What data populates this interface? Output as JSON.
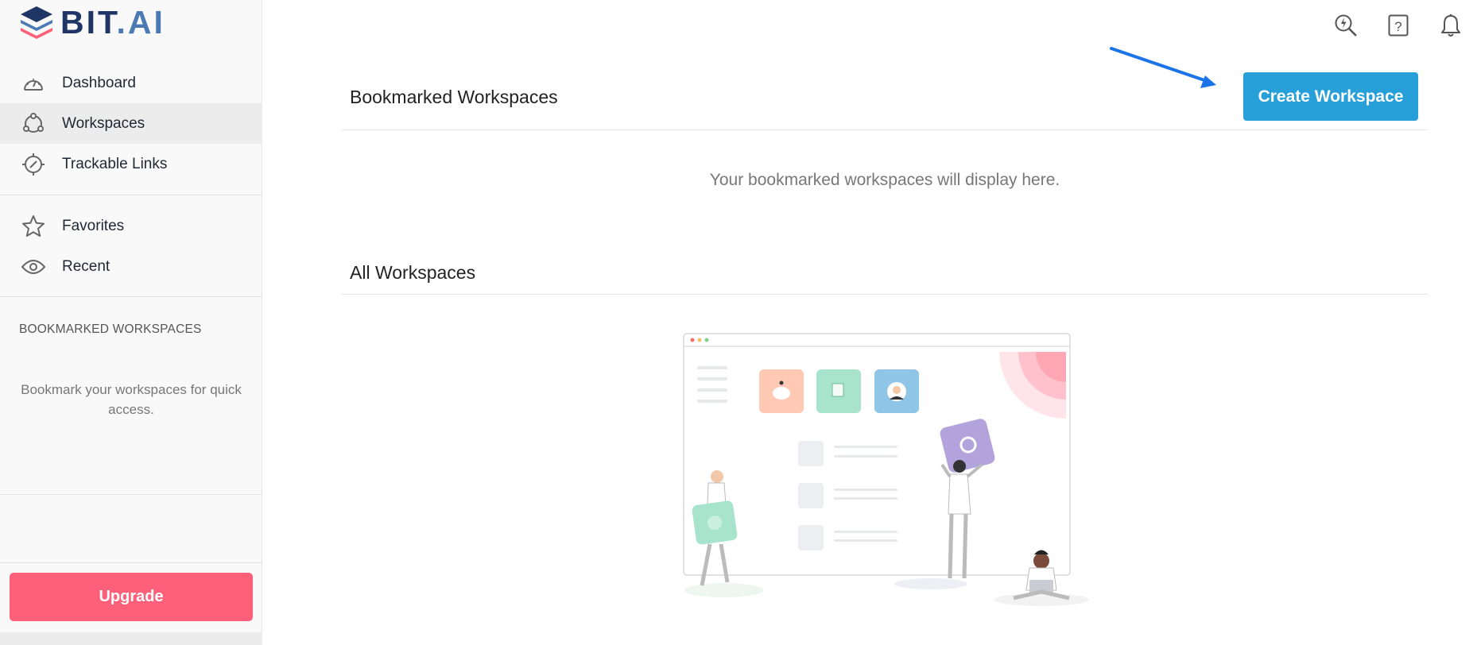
{
  "app": {
    "logo_main": "BIT",
    "logo_dot": ".",
    "logo_ai": "AI"
  },
  "sidebar": {
    "nav_primary": [
      {
        "label": "Dashboard",
        "icon": "gauge-icon"
      },
      {
        "label": "Workspaces",
        "icon": "workspaces-icon",
        "active": true
      },
      {
        "label": "Trackable Links",
        "icon": "trackable-link-icon"
      }
    ],
    "nav_secondary": [
      {
        "label": "Favorites",
        "icon": "star-icon"
      },
      {
        "label": "Recent",
        "icon": "eye-icon"
      }
    ],
    "bookmarked_title": "BOOKMARKED WORKSPACES",
    "bookmarked_hint": "Bookmark your workspaces for quick access.",
    "upgrade_label": "Upgrade"
  },
  "topbar": {
    "icons": [
      "search-bolt-icon",
      "help-icon",
      "bell-icon"
    ]
  },
  "main": {
    "bookmarked_heading": "Bookmarked Workspaces",
    "create_label": "Create Workspace",
    "bookmarked_empty": "Your bookmarked workspaces will display here.",
    "all_heading": "All Workspaces"
  },
  "colors": {
    "accent": "#27a0d9",
    "upgrade": "#fd6078",
    "logo": "#1e3566",
    "arrow": "#1a73e8"
  }
}
